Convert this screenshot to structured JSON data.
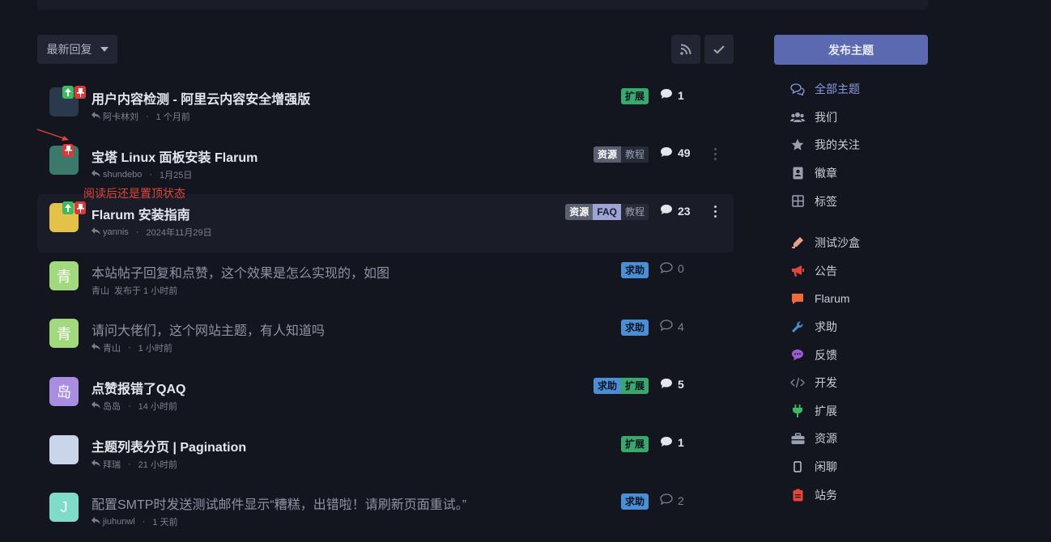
{
  "toolbar": {
    "sort_label": "最新回复",
    "rss_icon": "rss-icon",
    "mark_read_icon": "check-icon"
  },
  "discussions": [
    {
      "title": "用户内容检测 - 阿里云内容安全增强版",
      "user": "阿卡林刘",
      "time": "1 个月前",
      "replies": "1",
      "tags": [
        "扩展"
      ],
      "unread": true,
      "sticky": true,
      "avatar_text": "",
      "avatar_color": "#2a3a4c"
    },
    {
      "title": "宝塔 Linux 面板安装 Flarum",
      "user": "shundebo",
      "time": "1月25日",
      "replies": "49",
      "tags": [
        "资源",
        "教程"
      ],
      "unread": true,
      "sticky": true,
      "avatar_text": "",
      "avatar_color": "#3b7a6a"
    },
    {
      "title": "Flarum 安装指南",
      "user": "yannis",
      "time": "2024年11月29日",
      "replies": "23",
      "tags": [
        "资源",
        "FAQ",
        "教程"
      ],
      "unread": true,
      "sticky": true,
      "avatar_text": "",
      "avatar_color": "#e4c24a"
    },
    {
      "title": "本站帖子回复和点赞，这个效果是怎么实现的，如图",
      "user": "青山",
      "time": "发布于 1 小时前",
      "replies": "0",
      "tags": [
        "求助"
      ],
      "unread": false,
      "avatar_text": "青",
      "avatar_color": "#a3d97e"
    },
    {
      "title": "请问大佬们，这个网站主题，有人知道吗",
      "user": "青山",
      "time": "1 小时前",
      "replies": "4",
      "tags": [
        "求助"
      ],
      "unread": false,
      "avatar_text": "青",
      "avatar_color": "#a3d97e"
    },
    {
      "title": "点赞报错了QAQ",
      "user": "岛岛",
      "time": "14 小时前",
      "replies": "5",
      "tags": [
        "求助",
        "扩展"
      ],
      "unread": true,
      "avatar_text": "岛",
      "avatar_color": "#a88de0"
    },
    {
      "title": "主题列表分页 | Pagination",
      "user": "拜瑞",
      "time": "21 小时前",
      "replies": "1",
      "tags": [
        "扩展"
      ],
      "unread": true,
      "avatar_text": "",
      "avatar_color": "#c9d6ea"
    },
    {
      "title": "配置SMTP时发送测试邮件显示“糟糕，出错啦！请刷新页面重试。”",
      "user": "jiuhunwl",
      "time": "1 天前",
      "replies": "2",
      "tags": [
        "求助"
      ],
      "unread": false,
      "avatar_text": "J",
      "avatar_color": "#7fdcc8"
    }
  ],
  "annotation": "阅读后还是置顶状态",
  "sidebar": {
    "start_label": "发布主题",
    "nav": [
      {
        "label": "全部主题",
        "icon": "comments-icon",
        "color": "#8a98e0",
        "active": true
      },
      {
        "label": "我们",
        "icon": "users-icon",
        "color": "#9aa0b0"
      },
      {
        "label": "我的关注",
        "icon": "star-icon",
        "color": "#9aa0b0"
      },
      {
        "label": "徽章",
        "icon": "badge-icon",
        "color": "#9aa0b0"
      },
      {
        "label": "标签",
        "icon": "tags-icon",
        "color": "#9aa0b0"
      }
    ],
    "tags": [
      {
        "label": "测试沙盒",
        "icon": "sandbox-icon",
        "color": "#e8a08a"
      },
      {
        "label": "公告",
        "icon": "megaphone-icon",
        "color": "#e6453a"
      },
      {
        "label": "Flarum",
        "icon": "flarum-icon",
        "color": "#f06a3c"
      },
      {
        "label": "求助",
        "icon": "wrench-icon",
        "color": "#4a8fd6"
      },
      {
        "label": "反馈",
        "icon": "chat-icon",
        "color": "#a05ad6"
      },
      {
        "label": "开发",
        "icon": "code-icon",
        "color": "#7b8090"
      },
      {
        "label": "扩展",
        "icon": "plug-icon",
        "color": "#3fb860"
      },
      {
        "label": "资源",
        "icon": "toolbox-icon",
        "color": "#9aa0b0"
      },
      {
        "label": "闲聊",
        "icon": "phone-icon",
        "color": "#c9ccd6"
      },
      {
        "label": "站务",
        "icon": "clipboard-icon",
        "color": "#e6453a"
      }
    ]
  }
}
